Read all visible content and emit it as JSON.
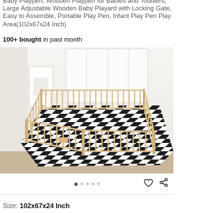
{
  "product": {
    "title": "Baby Playpen, Wooden Playpen for Babies and Toddlers, Large Adjustable Wooden Baby Playard with Locking Gate, Easy to Assemble, Portable Play Pen, Infant Play Pen Play Area(102x67x24 Inch)"
  },
  "purchase": {
    "bought_count": "100+ bought",
    "bought_suffix": " in past month"
  },
  "gallery": {
    "image_alt": "Wooden baby playpen on black and white checkered mat",
    "dot_count": 5,
    "active_index": 0
  },
  "actions": {
    "favorite_icon": "heart-icon",
    "share_icon": "share-icon"
  },
  "variant": {
    "size_label": "Size:",
    "size_value": "102x67x24 Inch"
  },
  "colors": {
    "wood": "#dcc095",
    "wall": "#f3f1ee",
    "checker_dark": "#1d1d1d",
    "checker_light": "#f7f7f7"
  }
}
